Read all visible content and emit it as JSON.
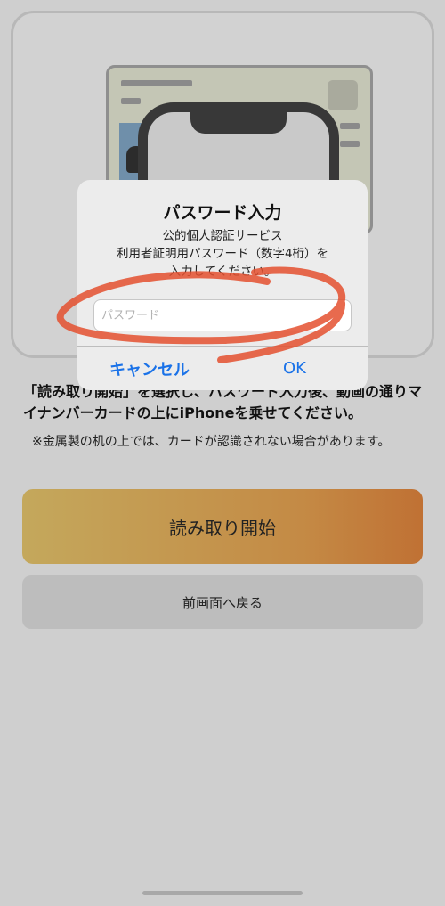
{
  "instruction": "「読み取り開始」を選択し、パスワード入力後、動画の通りマイナンバーカードの上にiPhoneを乗せてください。",
  "note": "※金属製の机の上では、カードが認識されない場合があります。",
  "buttons": {
    "start_label": "読み取り開始",
    "back_label": "前画面へ戻る"
  },
  "alert": {
    "title": "パスワード入力",
    "message_line1": "公的個人認証サービス",
    "message_line2": "利用者証明用パスワード（数字4桁）を",
    "message_line3": "入力してください。",
    "input_placeholder": "パスワード",
    "input_value": "",
    "cancel_label": "キャンセル",
    "ok_label": "OK"
  },
  "colors": {
    "accent_blue": "#1a72e8",
    "start_gradient_from": "#c4a85c",
    "start_gradient_to": "#c07134",
    "annotation_red": "#e4502f"
  },
  "icons": {
    "illustration": "mynumber-card-with-phone-illustration",
    "annotation": "red-hand-drawn-circle"
  }
}
